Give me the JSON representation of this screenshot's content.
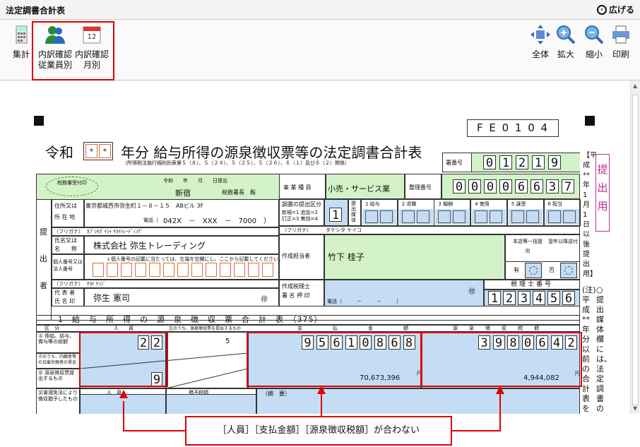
{
  "window": {
    "title": "法定調書合計表",
    "expand": "広げる"
  },
  "toolbar": {
    "sum": "集計",
    "emp1": "内訳確認",
    "emp2": "従業員別",
    "mon1": "内訳確認",
    "mon2": "月別",
    "all": "全体",
    "zin": "拡大",
    "zout": "縮小",
    "print": "印刷",
    "cal_day": "12"
  },
  "form": {
    "code": "F E 0 1 0 4",
    "reiwa": "令和",
    "year_digits": [
      "*",
      "*"
    ],
    "title": "年分 給与所得の源泉徴収票等の法定調書合計表",
    "subtitle": "（所得税法施行規則別表第５（８）、５（２４）、５（２５）、５（２６）、６（１）及び６（２）関係）",
    "office_no_label": "署番号",
    "office_no": [
      "0",
      "1",
      "2",
      "1",
      "9"
    ],
    "seal_circle": "税務署受付印",
    "date_row": "令和　　年　　月　　日提出",
    "office_name": "新宿",
    "office_head": "税務署長　殿",
    "business_label": "事 業 種 目",
    "business": "小売・サービス業",
    "ref_label": "整理番号",
    "ref_no": [
      "0",
      "0",
      "0",
      "0",
      "6",
      "6",
      "3",
      "7"
    ],
    "teishutsu": [
      "提",
      "出",
      "用"
    ],
    "side_top": "【平成**年1月1日以後提出用】",
    "addr_label1": "住所又は",
    "addr_label2": "所 在 地",
    "address": "東京都城西市弥生町１－８－１５　ABビル 3F",
    "tel_label": "電話（",
    "tel": "042X　－　XXX　－　7000　）",
    "furigana_label": "（フリガナ）",
    "company_kana": "ｶﾌﾞｼｷｶﾞｲｼｬ ﾔﾖｲﾄﾚｰﾃﾞｨﾝｸﾞ",
    "name_label1": "氏名又は",
    "name_label2": "名　　称",
    "company": "株式会社 弥生トレーディング",
    "kojin_label": "個人番号又は法人番号",
    "kojin_note": "↓個人番号の記載に当たっては、左端を空欄にし、ここから記載してください。",
    "teishutsusha": "提出者",
    "rep_kana": "ﾔﾖｲ ｹﾝｼﾞ",
    "rep_label1": "代 表 者",
    "rep_label2": "氏 名 印",
    "rep_name": "弥生 憲司",
    "seal": "㊞",
    "chosho_label": "調書の提出区分",
    "chosho_note": "新規=1 追加=2 訂正=3 無効=4",
    "kubun": "1",
    "baitai": "提出媒体",
    "media_cols": [
      "1 給与",
      "2 退職",
      "3 報酬",
      "4 使用",
      "5 譲受",
      "6 配当"
    ],
    "creator_kana": "タケシタ ケイコ",
    "creator_label": "作成担当者",
    "creator": "竹下 桂子",
    "honten_label": "本店等一括提出",
    "prev_label": "翌年以降送付",
    "yes": "有",
    "no": "否",
    "tax_label1": "作成税理士",
    "tax_label2": "署 名 押 印",
    "tax_no_label": "税理士番号",
    "tax_no": [
      "1",
      "2",
      "3",
      "4",
      "5",
      "6"
    ],
    "tel2": "電話（　　　－　　　－　　　）",
    "note_side": "(注) 平成**年分以前の合計表を作成",
    "note_circle": "○ 提出媒体欄には、法定調書の",
    "section": "1　給　与　所　得　の　源　泉　徴　収　票　合　計　表　（375）",
    "col_kubun": "区　分",
    "col_people": "人　　員",
    "col_hidden": "左のうち、源泉徴収票を提出するもの",
    "col_pay": "支　払　金　額",
    "col_tax": "源泉徴収税額",
    "row_a": "Ⓐ 俸給、給与、賞与等の総額",
    "row_a2": "Ⓐのうち、内職者等の日雇労務者の賃金",
    "row_b": "Ⓑ 源泉徴収票提出するもの",
    "row_c": "災害減免法により徴収猶予したもの",
    "people_a": [
      "2",
      "2"
    ],
    "hidden_a": "5",
    "pay_a": [
      "9",
      "5",
      "6",
      "1",
      "0",
      "8",
      "6",
      "8"
    ],
    "tax_a": [
      "3",
      "9",
      "8",
      "0",
      "6",
      "4",
      "2"
    ],
    "people_b": "9",
    "pay_b": "70,673,396",
    "tax_b": "4,944,082",
    "yen": "円",
    "tekiyo": "（摘　要）",
    "col_people2": "人　員",
    "col_yuyo": "猶予税額"
  },
  "callout": "［人員］［支払金額］［源泉徴収税額］が合わない"
}
